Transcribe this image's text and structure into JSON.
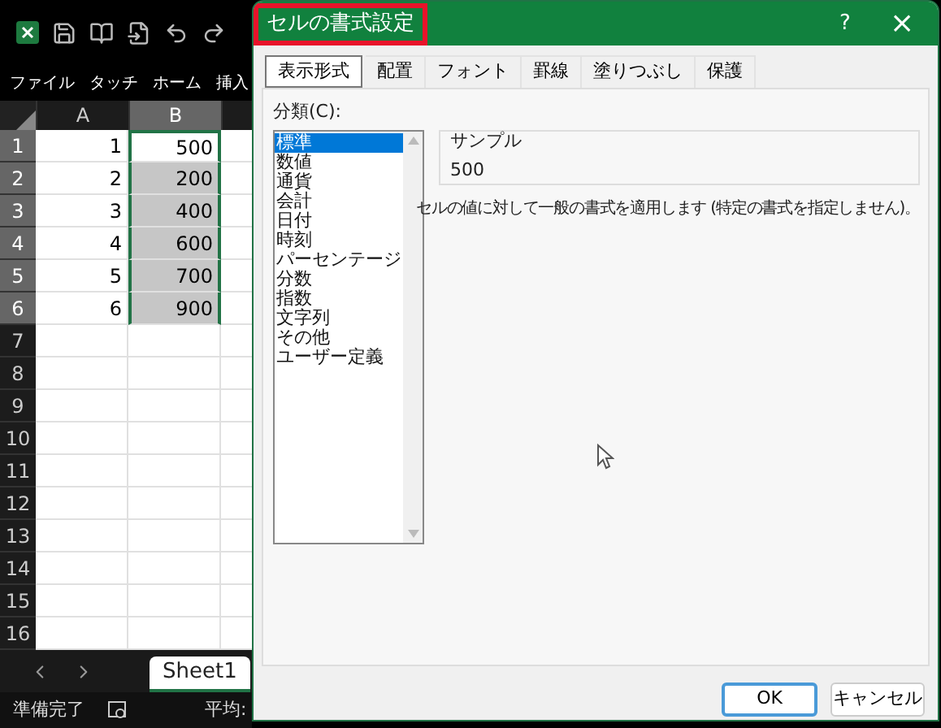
{
  "excel": {
    "ribbon_tabs": [
      "ファイル",
      "タッチ",
      "ホーム",
      "挿入"
    ],
    "columns": [
      {
        "label": "A",
        "selected": false
      },
      {
        "label": "B",
        "selected": true
      }
    ],
    "rows": [
      {
        "header": "1",
        "a": "1",
        "b": "500",
        "selected": true,
        "active": true
      },
      {
        "header": "2",
        "a": "2",
        "b": "200",
        "selected": true,
        "active": false
      },
      {
        "header": "3",
        "a": "3",
        "b": "400",
        "selected": true,
        "active": false
      },
      {
        "header": "4",
        "a": "4",
        "b": "600",
        "selected": true,
        "active": false
      },
      {
        "header": "5",
        "a": "5",
        "b": "700",
        "selected": true,
        "active": false
      },
      {
        "header": "6",
        "a": "6",
        "b": "900",
        "selected": true,
        "active": false
      },
      {
        "header": "7",
        "a": "",
        "b": "",
        "selected": false,
        "active": false
      },
      {
        "header": "8",
        "selected": false,
        "active": false
      },
      {
        "header": "9",
        "selected": false,
        "active": false
      },
      {
        "header": "10",
        "selected": false,
        "active": false
      },
      {
        "header": "11",
        "selected": false,
        "active": false
      },
      {
        "header": "12",
        "selected": false,
        "active": false
      },
      {
        "header": "13",
        "selected": false,
        "active": false
      },
      {
        "header": "14",
        "selected": false,
        "active": false
      },
      {
        "header": "15",
        "selected": false,
        "active": false
      },
      {
        "header": "16",
        "selected": false,
        "active": false
      }
    ],
    "sheet_tabs": [
      {
        "label": "Sheet1",
        "selected": true
      }
    ],
    "status_bar": {
      "ready": "準備完了",
      "average": "平均:"
    }
  },
  "dialog": {
    "title": "セルの書式設定",
    "help": "?",
    "close": "×",
    "tabs": [
      {
        "label": "表示形式",
        "selected": true
      },
      {
        "label": "配置",
        "selected": false
      },
      {
        "label": "フォント",
        "selected": false
      },
      {
        "label": "罫線",
        "selected": false
      },
      {
        "label": "塗りつぶし",
        "selected": false
      },
      {
        "label": "保護",
        "selected": false
      }
    ],
    "category_label": "分類(C):",
    "categories": [
      {
        "label": "標準",
        "selected": true
      },
      {
        "label": "数値",
        "selected": false
      },
      {
        "label": "通貨",
        "selected": false
      },
      {
        "label": "会計",
        "selected": false
      },
      {
        "label": "日付",
        "selected": false
      },
      {
        "label": "時刻",
        "selected": false
      },
      {
        "label": "パーセンテージ",
        "selected": false
      },
      {
        "label": "分数",
        "selected": false
      },
      {
        "label": "指数",
        "selected": false
      },
      {
        "label": "文字列",
        "selected": false
      },
      {
        "label": "その他",
        "selected": false
      },
      {
        "label": "ユーザー定義",
        "selected": false
      }
    ],
    "sample": {
      "label": "サンプル",
      "value": "500"
    },
    "description": "セルの値に対して一般の書式を適用します (特定の書式を指定しません)。",
    "buttons": [
      {
        "label": "OK",
        "kind": "primary"
      },
      {
        "label": "キャンセル",
        "kind": "secondary"
      }
    ]
  }
}
